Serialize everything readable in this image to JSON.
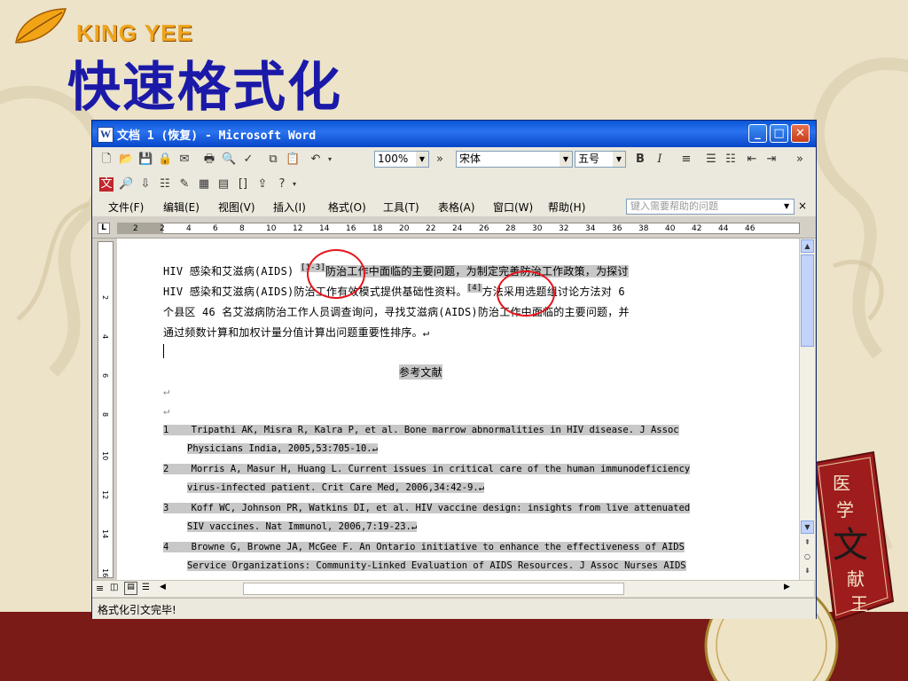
{
  "brand": "KING YEE",
  "slide_title": "快速格式化",
  "window": {
    "title": "文档 1 (恢复) - Microsoft Word",
    "buttons": {
      "minimize": "_",
      "maximize": "□",
      "close": "✕"
    }
  },
  "toolbar1": {
    "zoom": "100%",
    "font": "宋体",
    "font_size": "五号",
    "bold": "B",
    "italic": "I",
    "more": "»"
  },
  "menu": [
    {
      "label": "文件(F)"
    },
    {
      "label": "编辑(E)"
    },
    {
      "label": "视图(V)"
    },
    {
      "label": "插入(I)"
    },
    {
      "label": "格式(O)"
    },
    {
      "label": "工具(T)"
    },
    {
      "label": "表格(A)"
    },
    {
      "label": "窗口(W)"
    },
    {
      "label": "帮助(H)"
    }
  ],
  "help_placeholder": "键入需要帮助的问题",
  "ruler_numbers": [
    "2",
    "2",
    "4",
    "6",
    "8",
    "10",
    "12",
    "14",
    "16",
    "18",
    "20",
    "22",
    "24",
    "26",
    "28",
    "30",
    "32",
    "34",
    "36",
    "38",
    "40",
    "42",
    "44",
    "46"
  ],
  "vruler_numbers": [
    "2",
    "4",
    "6",
    "8",
    "10",
    "12",
    "14",
    "16"
  ],
  "document": {
    "para_line1_a": "HIV 感染和艾滋病(AIDS) ",
    "para_line1_sup": "[1-3]",
    "para_line1_b": "防治工作中面临的主要问题，为制定完善防治工作政策，为探讨",
    "para_line2_a": "HIV 感染和艾滋病(AIDS)防治工作有效模式提供基础性资料。",
    "para_line2_sup": "[4]",
    "para_line2_b": "方法采用选题组讨论方法对 6",
    "para_line3": "个县区 46 名艾滋病防治工作人员调查询问，寻找艾滋病(AIDS)防治工作中面临的主要问题，并",
    "para_line4": "通过频数计算和加权计量分值计算出问题重要性排序。↵",
    "references_heading": "参考文献",
    "references": [
      {
        "num": "1",
        "line1": "Tripathi AK, Misra R, Kalra P, et al. Bone marrow abnormalities in HIV disease. J Assoc",
        "line2": "Physicians India, 2005,53:705-10.↵"
      },
      {
        "num": "2",
        "line1": "Morris A, Masur H, Huang L. Current issues in critical care of the human immunodeficiency",
        "line2": "virus-infected patient. Crit Care Med, 2006,34:42-9.↵"
      },
      {
        "num": "3",
        "line1": "Koff WC, Johnson PR, Watkins DI, et al. HIV vaccine design: insights from live attenuated",
        "line2": "SIV vaccines. Nat Immunol, 2006,7:19-23.↵"
      },
      {
        "num": "4",
        "line1": "Browne G, Browne JA, McGee F. An Ontario initiative to enhance the effectiveness of AIDS",
        "line2": "Service Organizations: Community-Linked Evaluation of AIDS Resources. J Assoc Nurses AIDS"
      }
    ]
  },
  "status": "格式化引文完毕!",
  "book_text": [
    "医",
    "学",
    "文",
    "献",
    "王"
  ],
  "colors": {
    "title_blue": "#1b1aa8",
    "brand_orange": "#f0a51c",
    "circle_red": "#e8141b",
    "backdrop_red": "#7a1b18"
  }
}
